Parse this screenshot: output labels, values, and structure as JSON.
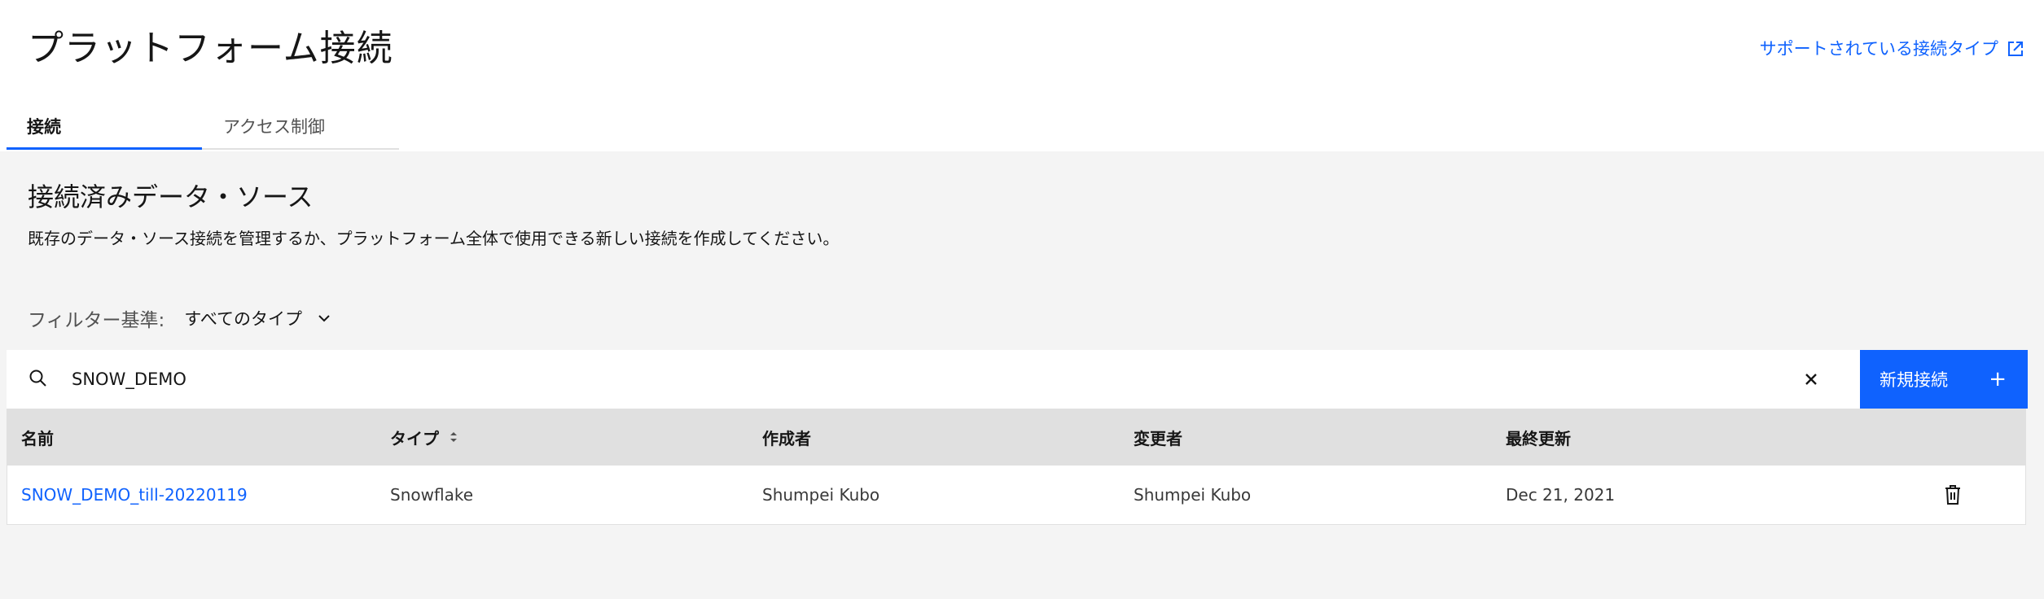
{
  "header": {
    "title": "プラットフォーム接続",
    "support_link": "サポートされている接続タイプ",
    "support_link_icon": "launch-icon"
  },
  "tabs": [
    {
      "label": "接続",
      "active": true
    },
    {
      "label": "アクセス制御",
      "active": false
    }
  ],
  "section": {
    "title": "接続済みデータ・ソース",
    "description": "既存のデータ・ソース接続を管理するか、プラットフォーム全体で使用できる新しい接続を作成してください。"
  },
  "filter": {
    "label": "フィルター基準:",
    "selected": "すべてのタイプ"
  },
  "search": {
    "value": "SNOW_DEMO",
    "placeholder": ""
  },
  "actions": {
    "new_connection": "新規接続",
    "new_connection_icon": "+"
  },
  "table": {
    "columns": [
      "名前",
      "タイプ",
      "作成者",
      "変更者",
      "最終更新"
    ],
    "rows": [
      {
        "name": "SNOW_DEMO_till-20220119",
        "type": "Snowflake",
        "created_by": "Shumpei Kubo",
        "modified_by": "Shumpei Kubo",
        "last_updated": "Dec 21, 2021"
      }
    ]
  },
  "colors": {
    "accent": "#0f62fe",
    "background": "#f4f4f4",
    "table_header": "#e0e0e0"
  }
}
